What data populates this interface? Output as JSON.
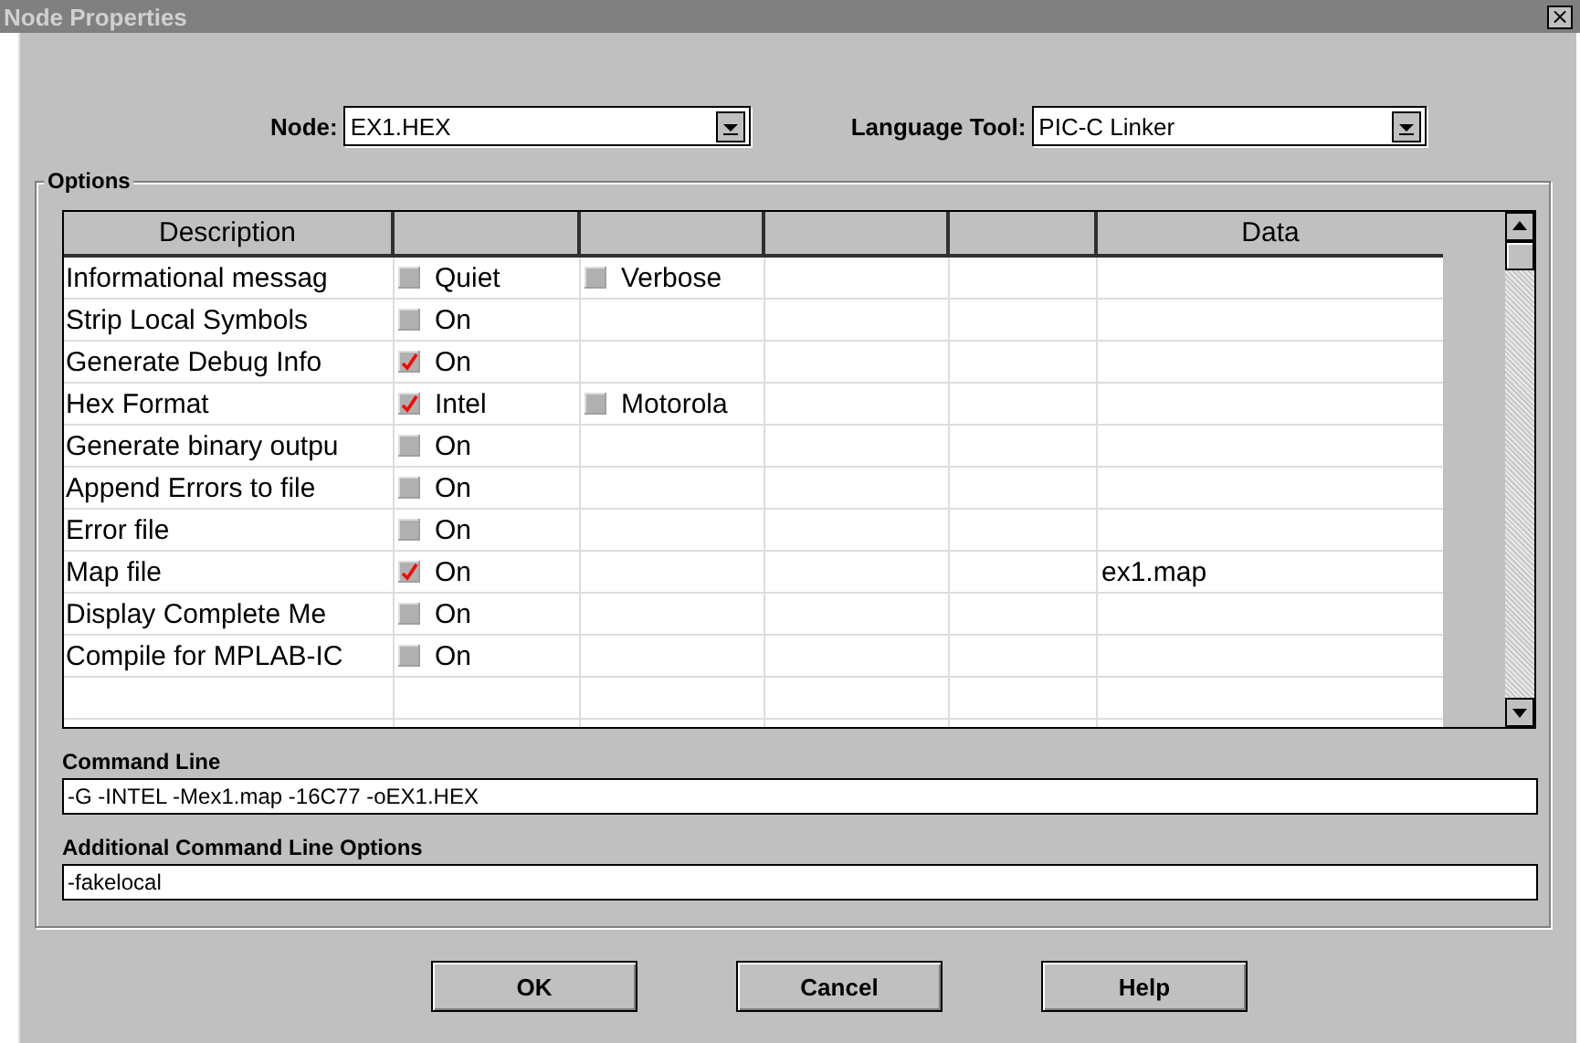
{
  "window": {
    "title": "Node Properties",
    "close": "×"
  },
  "node": {
    "label": "Node:",
    "value": "EX1.HEX"
  },
  "language_tool": {
    "label": "Language Tool:",
    "value": "PIC-C Linker"
  },
  "options": {
    "title": "Options",
    "description_heading": "Description",
    "data_heading": "Data",
    "rows": [
      {
        "description": "Informational messag",
        "options": [
          {
            "label": "Quiet",
            "checked": false
          },
          {
            "label": "Verbose",
            "checked": false
          }
        ]
      },
      {
        "description": "Strip Local Symbols",
        "options": [
          {
            "label": "On",
            "checked": false
          }
        ]
      },
      {
        "description": "Generate Debug Info",
        "options": [
          {
            "label": "On",
            "checked": true
          }
        ]
      },
      {
        "description": "Hex Format",
        "options": [
          {
            "label": "Intel",
            "checked": true
          },
          {
            "label": "Motorola",
            "checked": false
          }
        ]
      },
      {
        "description": "Generate binary outpu",
        "options": [
          {
            "label": "On",
            "checked": false
          }
        ]
      },
      {
        "description": "Append Errors to file",
        "options": [
          {
            "label": "On",
            "checked": false
          }
        ]
      },
      {
        "description": "Error file",
        "options": [
          {
            "label": "On",
            "checked": false
          }
        ]
      },
      {
        "description": "Map file",
        "options": [
          {
            "label": "On",
            "checked": true
          }
        ],
        "data": "ex1.map"
      },
      {
        "description": "Display Complete Me",
        "options": [
          {
            "label": "On",
            "checked": false
          }
        ]
      },
      {
        "description": "Compile for MPLAB-IC",
        "options": [
          {
            "label": "On",
            "checked": false
          }
        ]
      }
    ],
    "command_line": {
      "label": "Command Line",
      "value": "-G -INTEL -Mex1.map -16C77 -oEX1.HEX"
    },
    "additional": {
      "label": "Additional Command Line Options",
      "value": "-fakelocal"
    }
  },
  "buttons": [
    "OK",
    "Cancel",
    "Help"
  ]
}
